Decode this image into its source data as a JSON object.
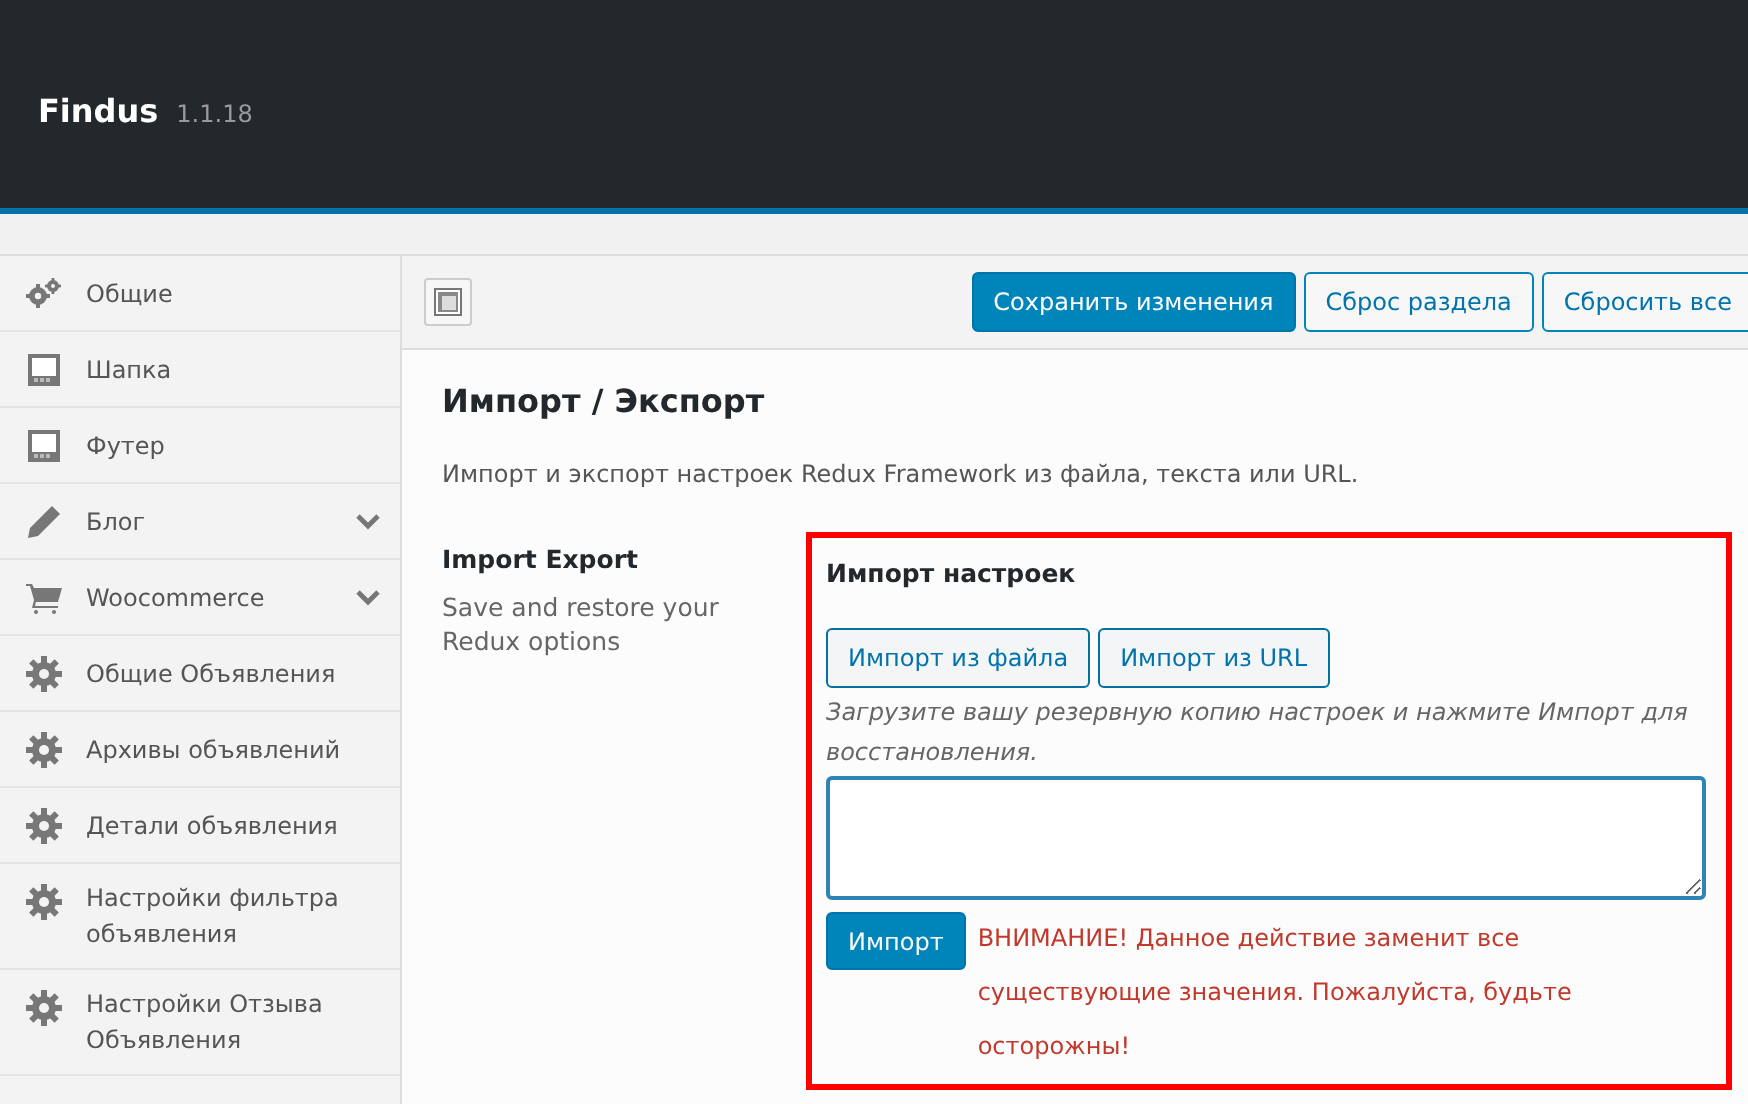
{
  "header": {
    "title": "Findus",
    "version": "1.1.18"
  },
  "sidebar": {
    "items": [
      {
        "label": "Общие",
        "kind": "gears",
        "expandable": false
      },
      {
        "label": "Шапка",
        "kind": "layout",
        "expandable": false
      },
      {
        "label": "Футер",
        "kind": "layout",
        "expandable": false
      },
      {
        "label": "Блог",
        "kind": "pencil",
        "expandable": true
      },
      {
        "label": "Woocommerce",
        "kind": "cart",
        "expandable": true
      },
      {
        "label": "Общие Объявления",
        "kind": "gear",
        "expandable": false
      },
      {
        "label": "Архивы объявлений",
        "kind": "gear",
        "expandable": false
      },
      {
        "label": "Детали объявления",
        "kind": "gear",
        "expandable": false
      },
      {
        "label": "Настройки фильтра объявления",
        "kind": "gear",
        "expandable": false
      },
      {
        "label": "Настройки Отзыва Объявления",
        "kind": "gear",
        "expandable": false
      }
    ]
  },
  "toolbar": {
    "buttons": [
      {
        "label": "Сохранить изменения",
        "kind": "primary"
      },
      {
        "label": "Сброс раздела",
        "kind": "secondary"
      },
      {
        "label": "Сбросить все",
        "kind": "secondary"
      }
    ]
  },
  "section": {
    "title": "Импорт / Экспорт",
    "description": "Импорт и экспорт настроек Redux Framework из файла, текста или URL."
  },
  "field": {
    "title": "Import Export",
    "subtitle": "Save and restore your Redux options",
    "panel": {
      "heading": "Импорт настроек",
      "buttons": [
        "Импорт из файла",
        "Импорт из URL"
      ],
      "hint": "Загрузите вашу резервную копию настроек и нажмите Импорт для восстановления.",
      "submit": "Импорт",
      "warning": "ВНИМАНИЕ! Данное действие заменит все существующие значения. Пожалуйста, будьте осторожны!"
    }
  }
}
